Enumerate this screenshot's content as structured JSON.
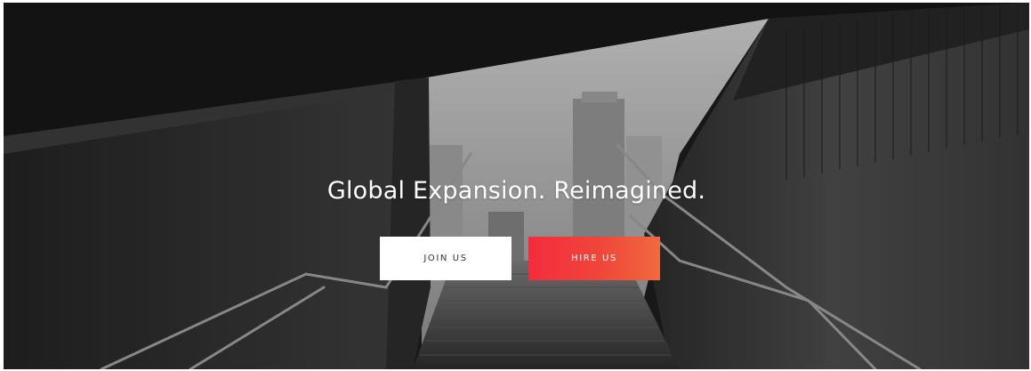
{
  "hero": {
    "headline": "Global Expansion. Reimagined.",
    "buttons": {
      "join_label": "JOIN US",
      "hire_label": "HIRE US"
    }
  },
  "colors": {
    "join_bg": "#ffffff",
    "join_text": "#333333",
    "hire_gradient_start": "#f32c3c",
    "hire_gradient_end": "#ef6a3e",
    "headline": "#ffffff"
  }
}
